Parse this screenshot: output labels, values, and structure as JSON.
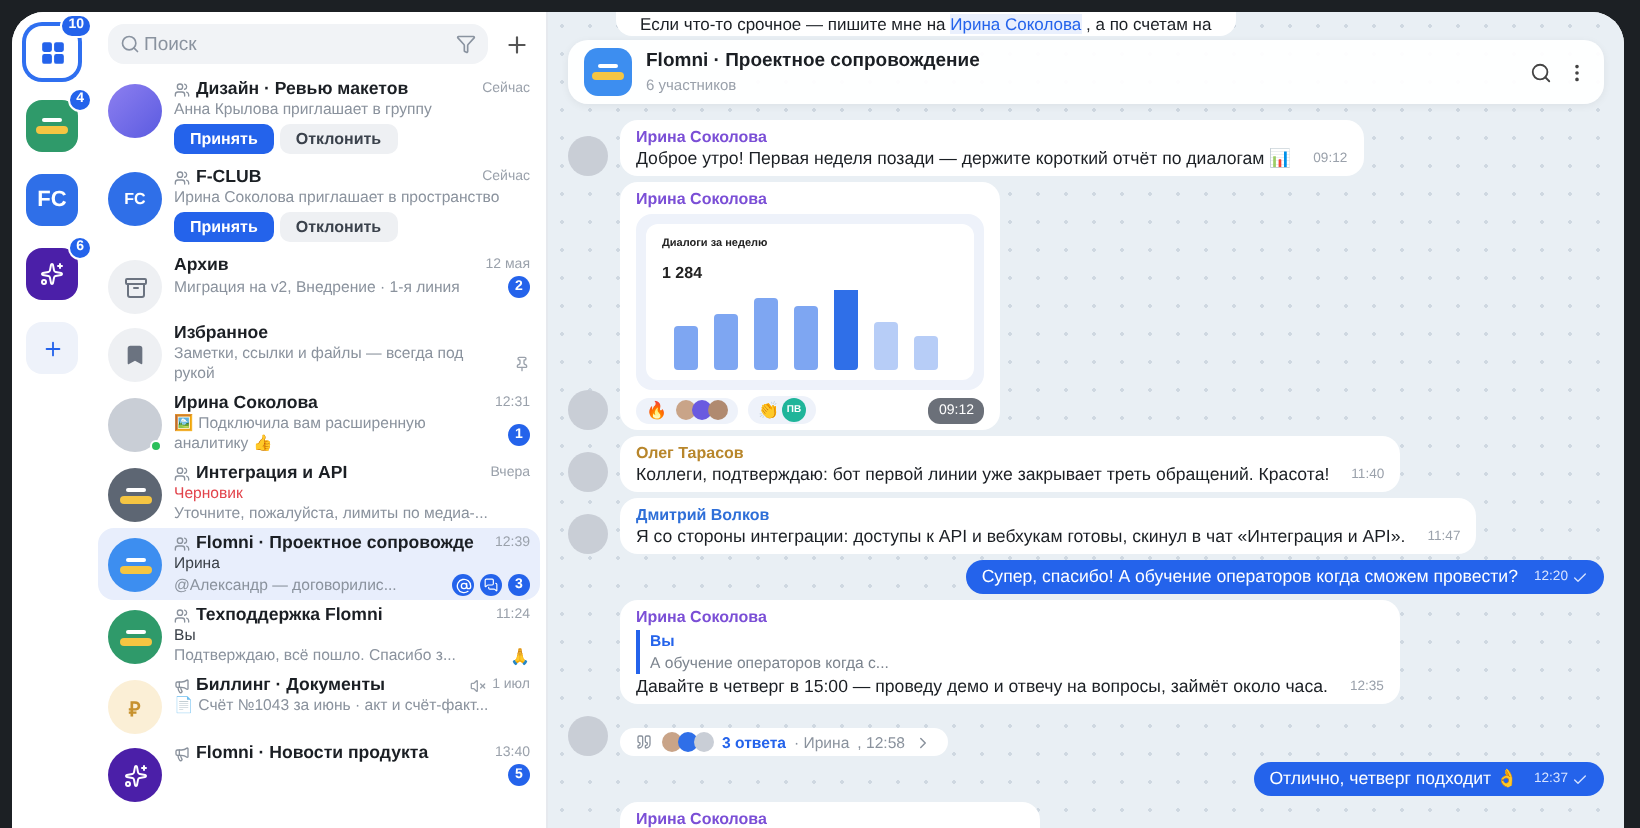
{
  "rail": [
    {
      "kind": "apps",
      "badge": "10",
      "selected": true
    },
    {
      "kind": "logo",
      "badge": "4",
      "selected": false
    },
    {
      "kind": "initials",
      "label": "FC",
      "selected": false
    },
    {
      "kind": "star",
      "badge": "6",
      "selected": false
    },
    {
      "kind": "add",
      "selected": false
    }
  ],
  "search": {
    "placeholder": "Поиск"
  },
  "chats": [
    {
      "kind": "gradient",
      "group": true,
      "channel": false,
      "title": "Дизайн · Ревью макетов",
      "time": "Сейчас",
      "lines": [
        "Анна Крылова приглашает в группу"
      ],
      "buttons": [
        "Принять",
        "Отклонить"
      ],
      "selected": false
    },
    {
      "kind": "initials",
      "initials": "FC",
      "group": true,
      "channel": false,
      "title": "F-CLUB",
      "time": "Сейчас",
      "lines": [
        "Ирина Соколова приглашает в пространство"
      ],
      "buttons": [
        "Принять",
        "Отклонить"
      ],
      "selected": false
    },
    {
      "kind": "archive",
      "group": false,
      "channel": false,
      "title": "Архив",
      "time": "12 мая",
      "lines": [
        "Миграция на v2, Внедрение · 1-я линия"
      ],
      "badge": "2",
      "selected": false
    },
    {
      "kind": "bookmark",
      "group": false,
      "channel": false,
      "title": "Избранное",
      "lines": [
        "Заметки, ссылки и файлы — всегда под рукой"
      ],
      "pinned": true,
      "selected": false
    },
    {
      "kind": "photo",
      "online": true,
      "group": false,
      "channel": false,
      "title": "Ирина Соколова",
      "time": "12:31",
      "lines": [
        "🖼️ Подключила вам расширенную аналитику 👍"
      ],
      "badge": "1",
      "selected": false
    },
    {
      "kind": "logo-dark",
      "group": true,
      "channel": false,
      "title": "Интеграция и API",
      "time": "Вчера",
      "draft": "Черновик",
      "lines": [
        "Уточните, пожалуйста, лимиты по медиа-..."
      ],
      "selected": false
    },
    {
      "kind": "logo-blue",
      "group": true,
      "channel": false,
      "title": "Flomni · Проектное сопровожде",
      "time": "12:39",
      "sender": "Ирина",
      "lines": [
        "@Александр — договорилис..."
      ],
      "mention": true,
      "badge": "3",
      "selected": true
    },
    {
      "kind": "logo-green",
      "group": true,
      "channel": false,
      "title": "Техподдержка Flomni",
      "time": "11:24",
      "sender": "Вы",
      "lines": [
        "Подтверждаю, всё пошло. Спасибо з..."
      ],
      "reaction": "🙏",
      "selected": false
    },
    {
      "kind": "ruble",
      "symbol": "₽",
      "group": false,
      "channel": true,
      "muted": true,
      "title": "Биллинг · Документы",
      "time": "1 июл",
      "lines": [
        "📄 Счёт №1043 за июнь · акт и счёт-факт..."
      ],
      "selected": false
    },
    {
      "kind": "star",
      "group": false,
      "channel": true,
      "title": "Flomni · Новости продукта",
      "time": "13:40",
      "badge": "5",
      "selected": false
    }
  ],
  "chat": {
    "title": "Flomni · Проектное сопровождение",
    "subtitle": "6 участников",
    "pinned_top": {
      "before": "Если что-то срочное — пишите мне на",
      "mention": "Ирина Соколова",
      "after": ", а по счетам на"
    },
    "messages": [
      {
        "kind": "text",
        "name": "Ирина Соколова",
        "color": "#7b4fd6",
        "text": "Доброе утро! Первая неделя позади — держите короткий отчёт по диалогам 📊",
        "time": "09:12",
        "avatar": true
      },
      {
        "kind": "image",
        "name": "Ирина Соколова",
        "color": "#7b4fd6",
        "card_title": "Диалоги за неделю",
        "card_value": "1 284",
        "reactions": [
          {
            "kind": "avatars",
            "emoji": "🔥"
          },
          {
            "kind": "initials",
            "emoji": "👏",
            "initials": "ПВ"
          }
        ],
        "time": "09:12",
        "avatar": true
      },
      {
        "kind": "text",
        "name": "Олег Тарасов",
        "color": "#b8862b",
        "text": "Коллеги, подтверждаю: бот первой линии уже закрывает треть обращений. Красота!",
        "time": "11:40",
        "avatar": true
      },
      {
        "kind": "text",
        "name": "Дмитрий Волков",
        "color": "#2f6fd8",
        "text": "Я со стороны интеграции: доступы к API и вебхукам готовы, скинул в чат «Интеграция и API».",
        "time": "11:47",
        "avatar": true
      },
      {
        "kind": "outgoing",
        "text": "Супер, спасибо! А обучение операторов когда сможем провести?",
        "time": "12:20"
      },
      {
        "kind": "reply",
        "name": "Ирина Соколова",
        "color": "#7b4fd6",
        "quote_name": "Вы",
        "quote_text": "А обучение операторов когда с...",
        "text": "Давайте в четверг в 15:00 — проведу демо и отвечу на вопросы, займёт около часа.",
        "time": "12:35",
        "avatar": false
      },
      {
        "kind": "thread",
        "replies": "3 ответа",
        "who": "· Ирина",
        "when": ", 12:58",
        "avatar": true
      },
      {
        "kind": "outgoing",
        "text": "Отлично, четверг подходит 👌",
        "time": "12:37"
      },
      {
        "kind": "cut",
        "name": "Ирина Соколова",
        "color": "#7b4fd6",
        "avatar": false
      }
    ]
  }
}
